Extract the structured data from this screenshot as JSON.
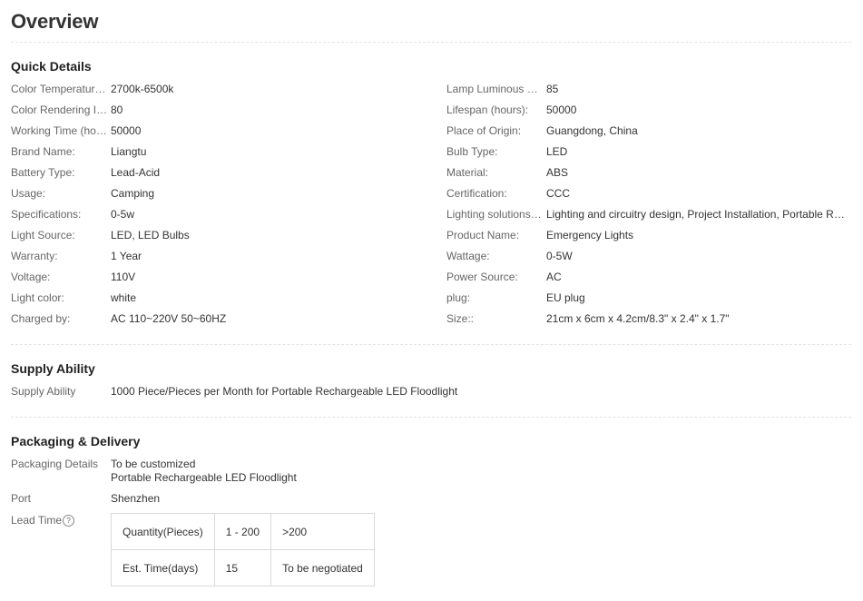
{
  "page": {
    "title": "Overview"
  },
  "quick_details": {
    "title": "Quick Details",
    "left": [
      {
        "key": "Color Temperature(...",
        "value": "2700k-6500k"
      },
      {
        "key": "Color Rendering In...",
        "value": "80"
      },
      {
        "key": "Working Time (hou...",
        "value": "50000"
      },
      {
        "key": "Brand Name:",
        "value": "Liangtu"
      },
      {
        "key": "Battery Type:",
        "value": "Lead-Acid"
      },
      {
        "key": "Usage:",
        "value": "Camping"
      },
      {
        "key": "Specifications:",
        "value": "0-5w"
      },
      {
        "key": "Light Source:",
        "value": "LED, LED Bulbs"
      },
      {
        "key": "Warranty:",
        "value": "1 Year"
      },
      {
        "key": "Voltage:",
        "value": "110V"
      },
      {
        "key": "Light color:",
        "value": "white"
      },
      {
        "key": "Charged by:",
        "value": "AC 110~220V 50~60HZ"
      }
    ],
    "right": [
      {
        "key": "Lamp Luminous Ef...",
        "value": "85"
      },
      {
        "key": "Lifespan (hours):",
        "value": "50000"
      },
      {
        "key": "Place of Origin:",
        "value": "Guangdong, China"
      },
      {
        "key": "Bulb Type:",
        "value": "LED"
      },
      {
        "key": "Material:",
        "value": "ABS"
      },
      {
        "key": "Certification:",
        "value": "CCC"
      },
      {
        "key": "Lighting solutions s...",
        "value": "Lighting and circuitry design, Project Installation, Portable Rec..."
      },
      {
        "key": "Product Name:",
        "value": "Emergency Lights"
      },
      {
        "key": "Wattage:",
        "value": "0-5W"
      },
      {
        "key": "Power Source:",
        "value": "AC"
      },
      {
        "key": "plug:",
        "value": "EU plug"
      },
      {
        "key": "Size::",
        "value": "21cm x 6cm x 4.2cm/8.3\" x 2.4\" x 1.7\""
      }
    ]
  },
  "supply_ability": {
    "title": "Supply Ability",
    "key": "Supply Ability",
    "value": "1000 Piece/Pieces per Month for Portable Rechargeable LED Floodlight"
  },
  "packaging": {
    "title": "Packaging & Delivery",
    "details_key": "Packaging Details",
    "details_line1": "To be customized",
    "details_line2": "Portable Rechargeable LED Floodlight",
    "port_key": "Port",
    "port_value": "Shenzhen",
    "lead_time_key": "Lead Time",
    "help_glyph": "?",
    "lead_table": [
      [
        "Quantity(Pieces)",
        "1 - 200",
        ">200"
      ],
      [
        "Est. Time(days)",
        "15",
        "To be negotiated"
      ]
    ]
  }
}
